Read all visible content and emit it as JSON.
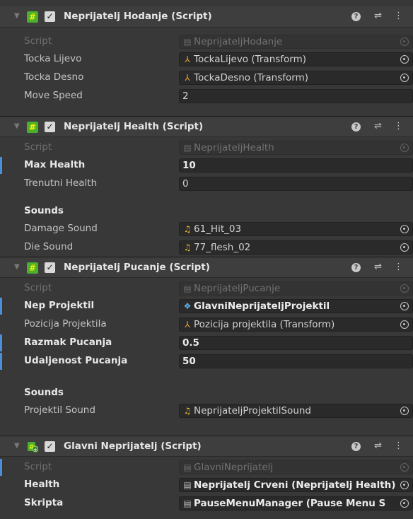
{
  "components": [
    {
      "title": "Neprijatelj Hodanje (Script)",
      "icon": "script-icon",
      "enabled": true,
      "rows": [
        {
          "label": "Script",
          "value": "NeprijateljHodanje",
          "icon": "script",
          "disabled": true
        },
        {
          "label": "Tocka Lijevo",
          "value": "TockaLijevo (Transform)",
          "icon": "transform"
        },
        {
          "label": "Tocka Desno",
          "value": "TockaDesno (Transform)",
          "icon": "transform"
        },
        {
          "label": "Move Speed",
          "value": "2"
        }
      ]
    },
    {
      "title": "Neprijatelj Health (Script)",
      "icon": "script-icon",
      "enabled": true,
      "rows": [
        {
          "label": "Script",
          "value": "NeprijateljHealth",
          "icon": "script",
          "disabled": true
        },
        {
          "label": "Max Health",
          "value": "10",
          "bold": true
        },
        {
          "label": "Trenutni Health",
          "value": "0"
        },
        {
          "section": "Sounds"
        },
        {
          "label": "Damage Sound",
          "value": "61_Hit_03",
          "icon": "audio"
        },
        {
          "label": "Die Sound",
          "value": "77_flesh_02",
          "icon": "audio"
        }
      ]
    },
    {
      "title": "Neprijatelj Pucanje (Script)",
      "icon": "script-icon",
      "enabled": true,
      "rows": [
        {
          "label": "Script",
          "value": "NeprijateljPucanje",
          "icon": "script",
          "disabled": true
        },
        {
          "label": "Nep Projektil",
          "value": "GlavniNeprijateljProjektil",
          "icon": "prefab",
          "bold": true
        },
        {
          "label": "Pozicija Projektila",
          "value": "Pozicija projektila (Transform)",
          "icon": "transform"
        },
        {
          "label": "Razmak Pucanja",
          "value": "0.5",
          "bold": true
        },
        {
          "label": "Udaljenost Pucanja",
          "value": "50",
          "bold": true
        },
        {
          "section": "Sounds"
        },
        {
          "label": "Projektil Sound",
          "value": "NeprijateljProjektilSound",
          "icon": "audio"
        }
      ]
    },
    {
      "title": "Glavni Neprijatelj (Script)",
      "icon": "added-script-icon",
      "enabled": true,
      "rows": [
        {
          "label": "Script",
          "value": "GlavniNeprijatelj",
          "icon": "script",
          "disabled": true
        },
        {
          "label": "Health",
          "value": "Neprijatelj Crveni (Neprijatelj Health)",
          "icon": "script",
          "bold": true
        },
        {
          "label": "Skripta",
          "value": "PauseMenuManager (Pause Menu S",
          "icon": "script",
          "bold": true
        }
      ]
    }
  ]
}
